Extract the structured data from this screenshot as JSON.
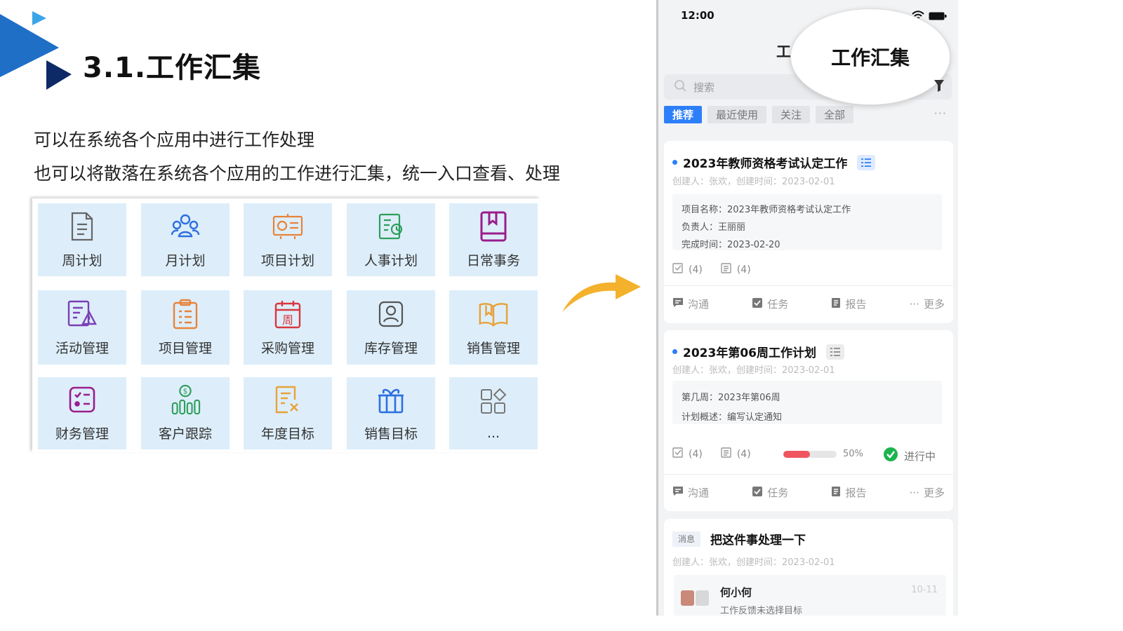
{
  "slide": {
    "title": "3.1.工作汇集",
    "desc_line1": "可以在系统各个应用中进行工作处理",
    "desc_line2": "也可以将散落在系统各个应用的工作进行汇集，统一入口查看、处理"
  },
  "apps": [
    {
      "label": "周计划",
      "icon": "document-icon",
      "color": "#666666"
    },
    {
      "label": "月计划",
      "icon": "group-icon",
      "color": "#2d6fe0"
    },
    {
      "label": "项目计划",
      "icon": "board-icon",
      "color": "#e8833a"
    },
    {
      "label": "人事计划",
      "icon": "alarm-doc-icon",
      "color": "#2e9e5b"
    },
    {
      "label": "日常事务",
      "icon": "book-icon",
      "color": "#9b1d8c"
    },
    {
      "label": "活动管理",
      "icon": "edit-warning-icon",
      "color": "#7b3fb5"
    },
    {
      "label": "项目管理",
      "icon": "clipboard-icon",
      "color": "#e8833a"
    },
    {
      "label": "采购管理",
      "icon": "calendar-week-icon",
      "color": "#d9363e"
    },
    {
      "label": "库存管理",
      "icon": "person-card-icon",
      "color": "#555555"
    },
    {
      "label": "销售管理",
      "icon": "open-book-icon",
      "color": "#e8a23a"
    },
    {
      "label": "财务管理",
      "icon": "list-box-icon",
      "color": "#9b1d8c"
    },
    {
      "label": "客户跟踪",
      "icon": "money-chart-icon",
      "color": "#2e9e5b"
    },
    {
      "label": "年度目标",
      "icon": "doc-x-icon",
      "color": "#e8a23a"
    },
    {
      "label": "销售目标",
      "icon": "gift-icon",
      "color": "#2d6fe0"
    },
    {
      "label": "...",
      "icon": "apps-more-icon",
      "color": "#777777"
    }
  ],
  "phone": {
    "time": "12:00",
    "title_small": "工",
    "zoom_title": "工作汇集",
    "search_placeholder": "搜索",
    "tabs": [
      {
        "label": "推荐",
        "active": true
      },
      {
        "label": "最近使用",
        "active": false
      },
      {
        "label": "关注",
        "active": false
      },
      {
        "label": "全部",
        "active": false
      }
    ],
    "tabs_more": "···",
    "card1": {
      "title": "2023年教师资格考试认定工作",
      "meta": "创建人：张欢，创建时间：2023-02-01",
      "rows": [
        "项目名称：2023年教师资格考试认定工作",
        "负责人：王丽丽",
        "完成时间：2023-02-20"
      ],
      "tasks": "(4)",
      "docs": "(4)"
    },
    "card2": {
      "title": "2023年第06周工作计划",
      "meta": "创建人：张欢，创建时间：2023-02-01",
      "rows": [
        "第几周：2023年第06周",
        "计划概述：编写认定通知"
      ],
      "tasks": "(4)",
      "docs": "(4)",
      "progress": 50,
      "progress_label": "50%",
      "status": "进行中"
    },
    "actions": [
      "沟通",
      "任务",
      "报告",
      "更多"
    ],
    "card3": {
      "tag": "消息",
      "title": "把这件事处理一下",
      "meta": "创建人：张欢，创建时间：2023-02-01",
      "name": "何小何",
      "date": "10-11",
      "text": "工作反馈未选择目标"
    }
  }
}
